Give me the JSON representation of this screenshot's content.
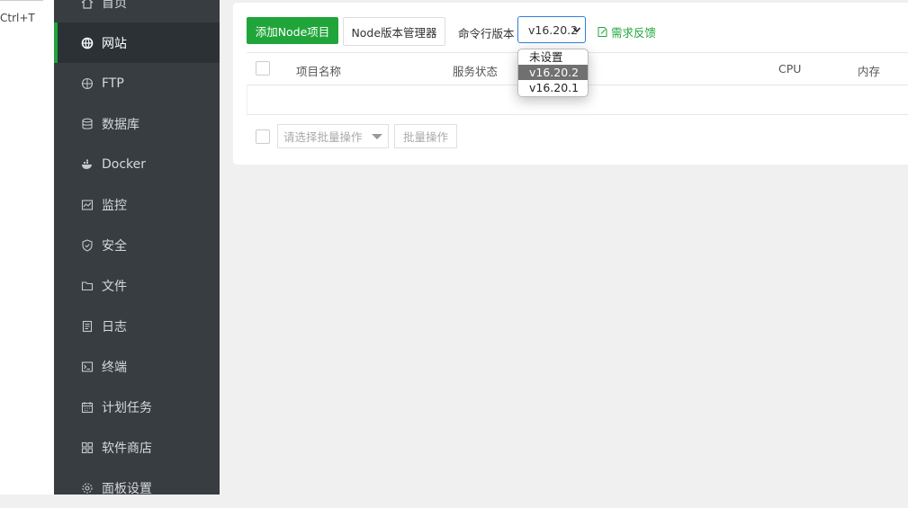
{
  "browser": {
    "shortcut_hint": "Ctrl+T"
  },
  "sidebar": {
    "items": [
      {
        "label": "首页",
        "icon": "home-icon"
      },
      {
        "label": "网站",
        "icon": "globe-icon",
        "active": true
      },
      {
        "label": "FTP",
        "icon": "ftp-globe-icon"
      },
      {
        "label": "数据库",
        "icon": "database-icon"
      },
      {
        "label": "Docker",
        "icon": "docker-icon"
      },
      {
        "label": "监控",
        "icon": "monitor-icon"
      },
      {
        "label": "安全",
        "icon": "shield-icon"
      },
      {
        "label": "文件",
        "icon": "folder-icon"
      },
      {
        "label": "日志",
        "icon": "log-icon"
      },
      {
        "label": "终端",
        "icon": "terminal-icon"
      },
      {
        "label": "计划任务",
        "icon": "calendar-icon"
      },
      {
        "label": "软件商店",
        "icon": "apps-icon"
      },
      {
        "label": "面板设置",
        "icon": "settings-icon"
      }
    ]
  },
  "toolbar": {
    "add_node_label": "添加Node项目",
    "version_manager_label": "Node版本管理器",
    "cli_version_label": "命令行版本",
    "cli_version_value": "v16.20.2",
    "feedback_label": "需求反馈"
  },
  "dropdown": {
    "options": [
      "未设置",
      "v16.20.2",
      "v16.20.1"
    ],
    "selected": "v16.20.2"
  },
  "table": {
    "columns": [
      "项目名称",
      "服务状态",
      "CPU",
      "内存"
    ]
  },
  "batch": {
    "select_placeholder": "请选择批量操作",
    "button_label": "批量操作"
  },
  "colors": {
    "accent": "#20a53a",
    "sidebar_bg": "#383d42",
    "focus_border": "#2f7fdc"
  }
}
